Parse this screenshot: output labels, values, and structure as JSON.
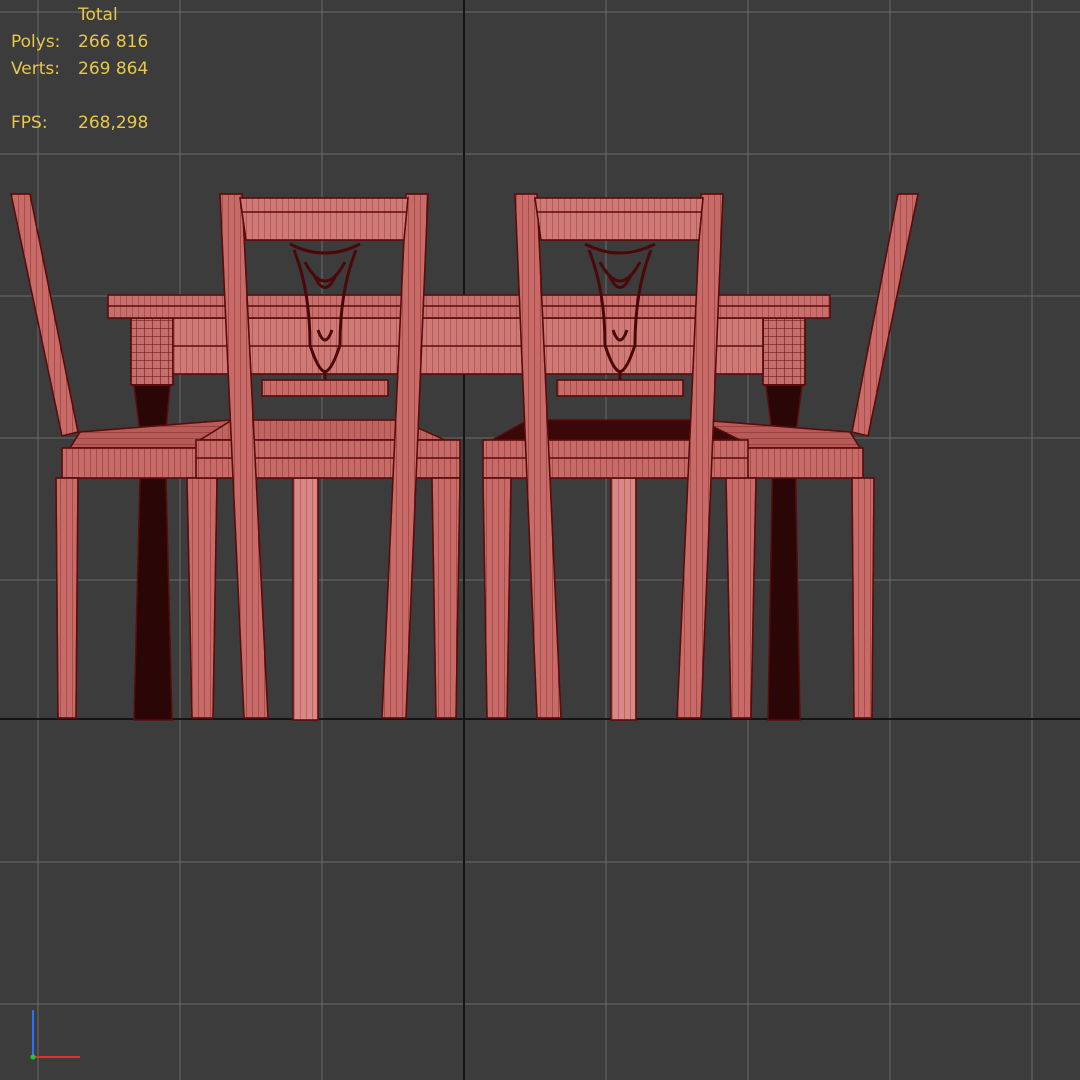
{
  "viewport": {
    "view": "front",
    "shading": "wireframe-over-shaded",
    "colors": {
      "background": "#3c3c3c",
      "grid": "#6a6a6a",
      "axis_line": "#141414",
      "mesh_fill": "#d07a78",
      "mesh_wire": "#5a0c0c",
      "stats_text": "#e8c84a"
    }
  },
  "stats": {
    "header": "Total",
    "polys_label": "Polys:",
    "polys_value": "266 816",
    "verts_label": "Verts:",
    "verts_value": "269 864",
    "fps_label": "FPS:",
    "fps_value": "268,298"
  },
  "gizmo": {
    "icon": "axis-tripod-icon",
    "x_color": "#e03030",
    "z_color": "#3070ff"
  }
}
